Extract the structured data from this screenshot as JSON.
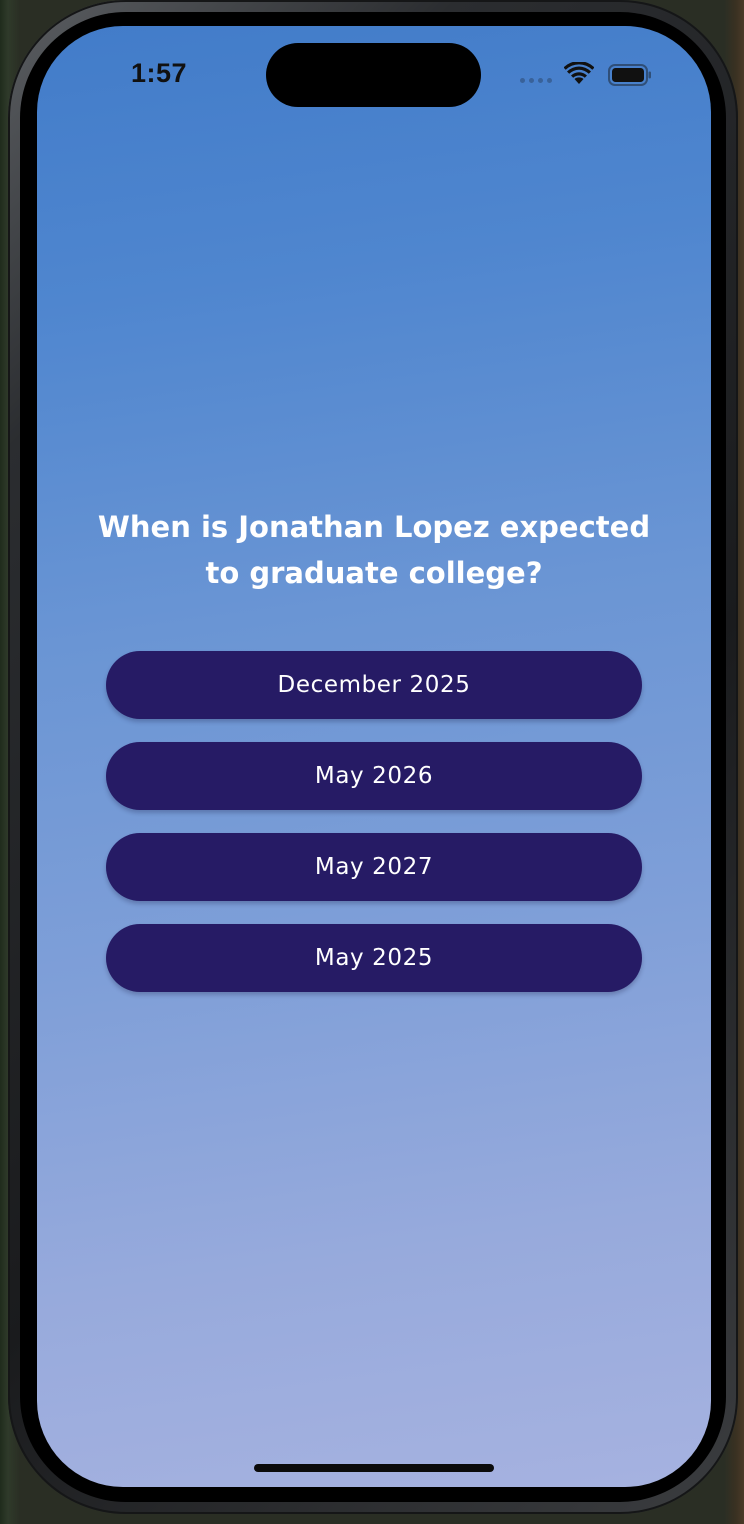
{
  "status_bar": {
    "time": "1:57",
    "icons": [
      "signal-icon",
      "wifi-icon",
      "battery-icon"
    ]
  },
  "quiz": {
    "question": "When is Jonathan Lopez expected to graduate college?",
    "answers": [
      {
        "label": "December 2025"
      },
      {
        "label": "May 2026"
      },
      {
        "label": "May 2027"
      },
      {
        "label": "May 2025"
      }
    ]
  },
  "colors": {
    "background_top": "#427cc9",
    "background_bottom": "#a6b2e0",
    "answer_button": "#261b65",
    "text": "#ffffff"
  }
}
